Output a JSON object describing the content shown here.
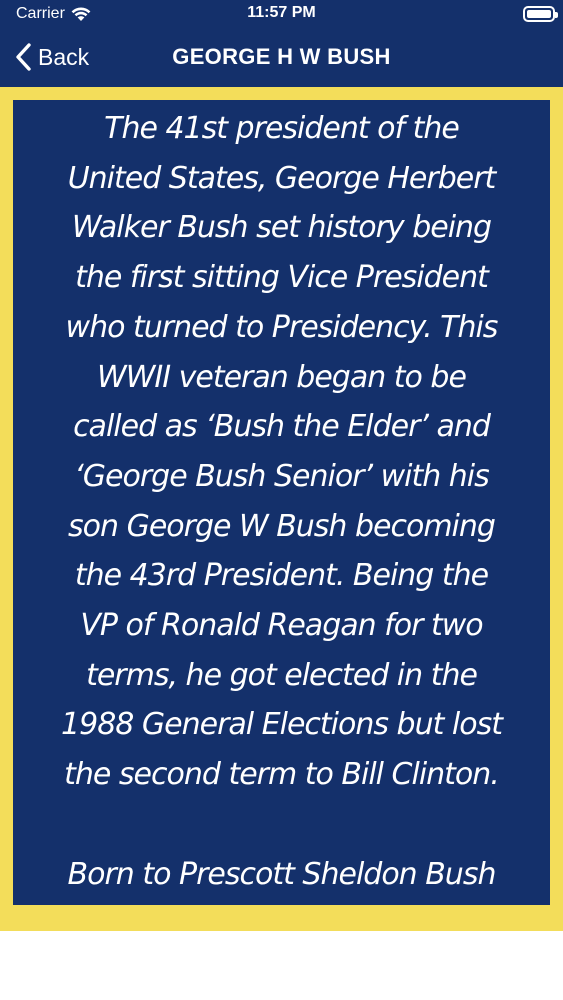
{
  "status_bar": {
    "carrier": "Carrier",
    "time": "11:57 PM",
    "wifi_icon": "wifi-icon",
    "battery_icon": "battery-icon"
  },
  "nav": {
    "back_label": "Back",
    "title": "GEORGE H W BUSH"
  },
  "content": {
    "body": "The 41st president of the\nUnited States, George Herbert\nWalker Bush set history being\nthe first sitting Vice President\nwho turned to Presidency. This\nWWII veteran began to be\ncalled as ‘Bush the Elder’ and\n‘George Bush Senior’ with his\nson George W Bush becoming\nthe 43rd President. Being the\nVP of Ronald Reagan for two\nterms, he got elected in the\n1988 General Elections but lost\nthe second term to Bill Clinton.\n\nBorn to  Prescott Sheldon Bush\nand Dorothy Walker Bush"
  },
  "colors": {
    "navy": "#14306b",
    "yellow": "#f3dd5a",
    "text": "#ffffff"
  }
}
